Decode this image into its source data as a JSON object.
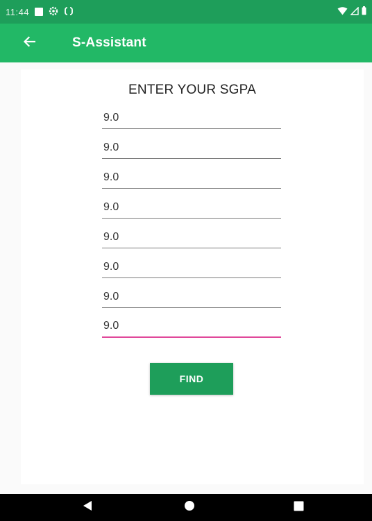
{
  "status_bar": {
    "time": "11:44",
    "icons": [
      "notification-square-icon",
      "settings-icon",
      "sync-icon",
      "wifi-icon",
      "signal-icon",
      "battery-icon"
    ]
  },
  "app_bar": {
    "title": "S-Assistant",
    "back_icon": "arrow-left-icon",
    "color": "#22b866"
  },
  "form": {
    "heading": "ENTER YOUR SGPA",
    "fields": [
      {
        "value": "9.0"
      },
      {
        "value": "9.0"
      },
      {
        "value": "9.0"
      },
      {
        "value": "9.0"
      },
      {
        "value": "9.0"
      },
      {
        "value": "9.0"
      },
      {
        "value": "9.0"
      },
      {
        "value": "9.0",
        "focused": true
      }
    ],
    "button_label": "FIND",
    "focus_color": "#e0489a"
  },
  "nav_bar": {
    "icons": [
      "back-triangle-icon",
      "home-circle-icon",
      "recents-square-icon"
    ]
  }
}
